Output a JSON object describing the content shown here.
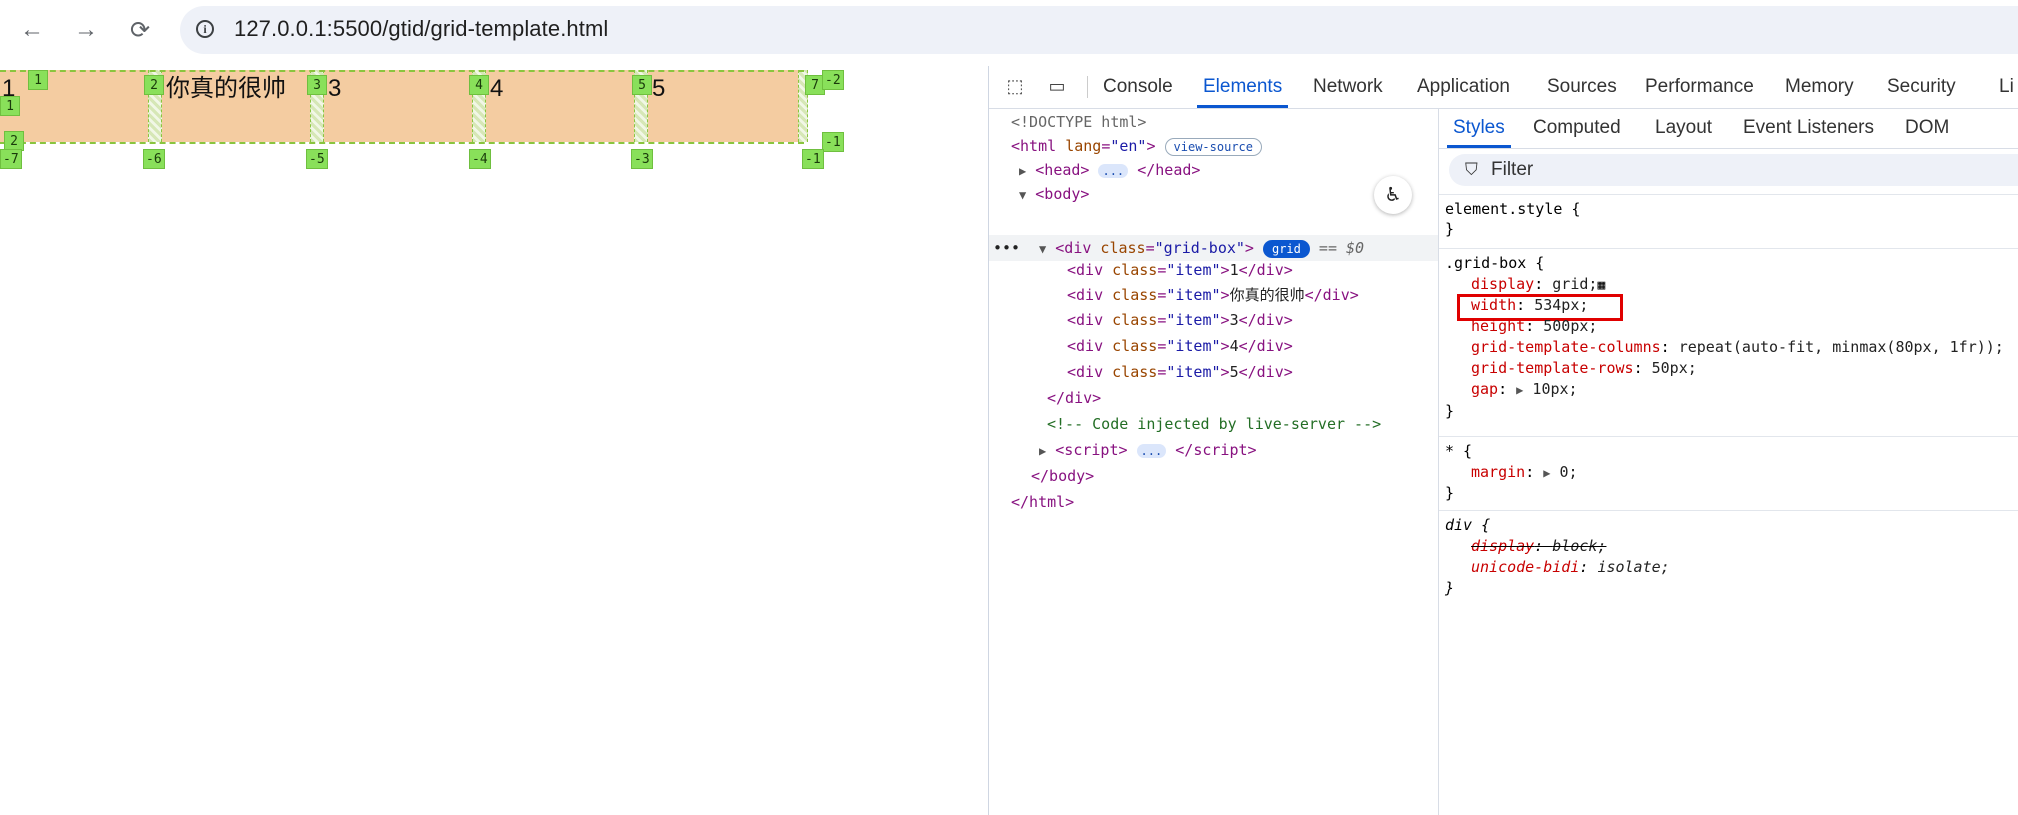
{
  "browser": {
    "url": "127.0.0.1:5500/gtid/grid-template.html",
    "icons": [
      "back-arrow-icon",
      "forward-arrow-icon",
      "reload-icon",
      "info-icon"
    ]
  },
  "page": {
    "items": [
      "1",
      "你真的很帅",
      "3",
      "4",
      "5"
    ],
    "column_line_labels_positive": [
      "1",
      "2",
      "3",
      "4",
      "5",
      "7"
    ],
    "column_line_labels_negative": [
      "-7",
      "-6",
      "-5",
      "-4",
      "-3",
      "-1"
    ],
    "row_line_labels": [
      "1",
      "2",
      "-2",
      "-1"
    ]
  },
  "devtools": {
    "tabs": [
      "Console",
      "Elements",
      "Network",
      "Application",
      "Sources",
      "Performance",
      "Memory",
      "Security",
      "Li"
    ],
    "active_tab": "Elements",
    "dom": {
      "doctype": "<!DOCTYPE html>",
      "html_open": "html",
      "lang_attr": "lang",
      "lang_val": "\"en\"",
      "view_source": "view-source",
      "head": "head",
      "body": "body",
      "div_tag": "div",
      "class_attr": "class",
      "grid_box_val": "\"grid-box\"",
      "grid_badge": "grid",
      "eq_dollar": "== $0",
      "item_val": "\"item\"",
      "item_texts": [
        "1",
        "你真的很帅",
        "3",
        "4",
        "5"
      ],
      "div_close": "</div>",
      "comment": "<!-- Code injected by live-server -->",
      "script": "script",
      "body_close": "</body>",
      "html_close": "</html>",
      "ellipsis": "..."
    },
    "styles_tabs": [
      "Styles",
      "Computed",
      "Layout",
      "Event Listeners",
      "DOM Breakpo"
    ],
    "active_styles_tab": "Styles",
    "filter_placeholder": "Filter",
    "rules": {
      "element_style": "element.style {",
      "close": "}",
      "grid_box_selector": ".grid-box {",
      "display_prop": "display",
      "display_val": "grid;",
      "width_prop": "width",
      "width_val": "534px;",
      "height_prop": "height",
      "height_val": "500px;",
      "gtc_prop": "grid-template-columns",
      "gtc_val": "repeat(auto-fit, minmax(80px, 1fr));",
      "gtr_prop": "grid-template-rows",
      "gtr_val": "50px;",
      "gap_prop": "gap",
      "gap_val": "10px;",
      "star_selector": "* {",
      "margin_prop": "margin",
      "margin_val": "0;",
      "div_selector": "div {",
      "ua_display_prop": "display",
      "ua_display_val": "block;",
      "unicode_bidi_prop": "unicode-bidi",
      "unicode_bidi_val": "isolate;"
    }
  }
}
